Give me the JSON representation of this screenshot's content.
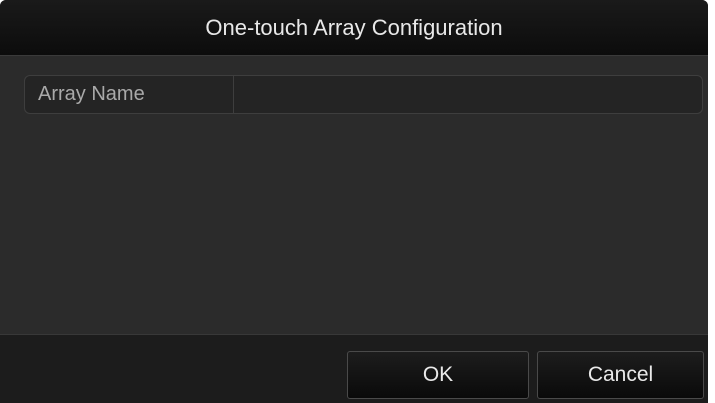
{
  "dialog": {
    "title": "One-touch Array Configuration"
  },
  "form": {
    "array_name_label": "Array Name",
    "array_name_value": ""
  },
  "buttons": {
    "ok_label": "OK",
    "cancel_label": "Cancel"
  }
}
